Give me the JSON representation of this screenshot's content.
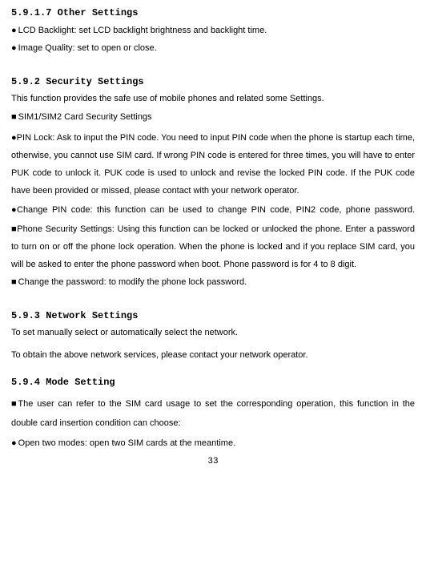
{
  "section1": {
    "heading": "5.9.1.7 Other Settings",
    "bullet1_mark": "●",
    "bullet1_text": "LCD Backlight: set LCD backlight brightness and backlight time.",
    "bullet2_mark": "●",
    "bullet2_text": "Image Quality: set to open or close."
  },
  "section2": {
    "heading": "5.9.2 Security Settings",
    "intro": "This function provides the safe use of mobile phones and related some Settings.",
    "sim_mark": "■",
    "sim_text": "SIM1/SIM2 Card Security Settings",
    "pinlock_text": "●PIN Lock: Ask to input the PIN code. You need to input PIN code when the phone is startup each time, otherwise, you cannot use SIM card. If wrong PIN code is entered for three times, you will have to enter PUK code to unlock it. PUK code is used to unlock and revise the locked PIN code. If the PUK code have been provided or missed, please contact with your network operator.",
    "change_pin_text": "●Change PIN code: this function can be used to change PIN code, PIN2 code, phone password.",
    "phone_sec_text": "■Phone Security Settings: Using this function can be locked or unlocked the phone. Enter a password to turn on or off the phone lock operation. When the phone is locked and if you replace SIM card, you will be asked to enter the phone password when boot. Phone password is for 4 to 8 digit.",
    "change_pwd_mark": "■",
    "change_pwd_text": "Change the password: to modify the phone lock password."
  },
  "section3": {
    "heading": "5.9.3 Network Settings",
    "line1": "To set manually select or automatically select the network.",
    "line2": "To obtain the above network services, please contact your network operator."
  },
  "section4": {
    "heading": "5.9.4 Mode Setting",
    "sim_usage_text": "■The user can refer to the SIM card usage to set the corresponding operation, this function in the double card insertion condition can choose:",
    "open_two_mark": "●",
    "open_two_text": "Open two modes: open two SIM cards at the meantime."
  },
  "page_number": "33"
}
